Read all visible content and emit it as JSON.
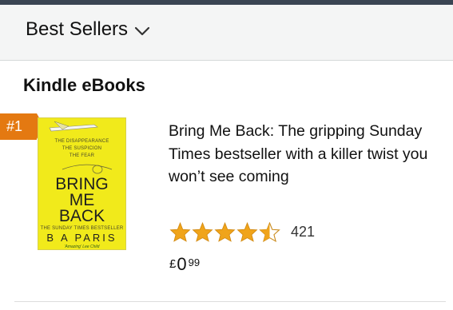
{
  "header": {
    "title": "Best Sellers",
    "dropdown_icon": "chevron-down-icon"
  },
  "section": {
    "title": "Kindle eBooks"
  },
  "item": {
    "rank": "#1",
    "title": "Bring Me Back: The gripping Sunday Times bestseller with a killer twist you won’t see coming",
    "rating_stars": 4.5,
    "rating_count": "421",
    "price": {
      "currency": "£",
      "whole": "0",
      "fraction": "99"
    },
    "cover": {
      "tagline_1": "THE DISAPPEARANCE",
      "tagline_2": "THE SUSPICION",
      "tagline_3": "THE FEAR",
      "word_1": "BRING",
      "word_2": "ME",
      "word_3": "BACK",
      "bestseller": "THE SUNDAY TIMES BESTSELLER",
      "author": "B A PARIS",
      "quote": "'Amazing' Lee Child",
      "background_color": "#f1ea1b"
    }
  },
  "colors": {
    "rank_badge": "#e47911",
    "star": "#f0a41a",
    "header_bg": "#f4f5f5",
    "top_bar": "#3a4553"
  }
}
